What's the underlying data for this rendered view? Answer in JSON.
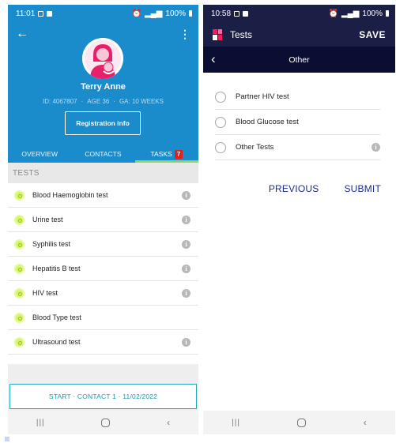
{
  "left": {
    "status": {
      "time": "11:01",
      "battery": "100%"
    },
    "header": {
      "name": "Terry Anne",
      "id": "ID: 4067807",
      "age": "AGE 36",
      "ga": "GA: 10 WEEKS",
      "registration_btn": "Registration info"
    },
    "tabs": [
      {
        "label": "OVERVIEW"
      },
      {
        "label": "CONTACTS"
      },
      {
        "label": "TASKS",
        "badge": "7"
      }
    ],
    "section_title": "TESTS",
    "tests": [
      {
        "label": "Blood Haemoglobin test",
        "info": true
      },
      {
        "label": "Urine test",
        "info": true
      },
      {
        "label": "Syphilis test",
        "info": true
      },
      {
        "label": "Hepatitis B test",
        "info": true
      },
      {
        "label": "HIV test",
        "info": true
      },
      {
        "label": "Blood Type test",
        "info": false
      },
      {
        "label": "Ultrasound test",
        "info": true
      }
    ],
    "start_btn": "START · CONTACT 1 · 11/02/2022"
  },
  "right": {
    "status": {
      "time": "10:58",
      "battery": "100%"
    },
    "toolbar": {
      "title": "Tests",
      "save": "SAVE"
    },
    "sub_title": "Other",
    "options": [
      {
        "label": "Partner HIV test",
        "info": false
      },
      {
        "label": "Blood Glucose test",
        "info": false
      },
      {
        "label": "Other Tests",
        "info": true
      }
    ],
    "previous_btn": "PREVIOUS",
    "submit_btn": "SUBMIT"
  },
  "colors": {
    "primary_blue": "#1b8ccb",
    "navy": "#1b1f45",
    "tab_indicator": "#8fd36a",
    "badge_red": "#e02020",
    "action_blue": "#1d2b8c"
  }
}
